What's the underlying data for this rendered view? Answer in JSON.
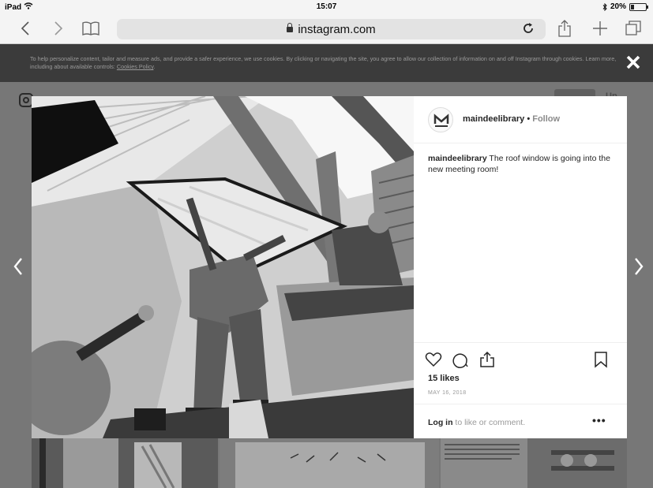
{
  "status_bar": {
    "device": "iPad",
    "time": "15:07",
    "battery": "20%"
  },
  "browser": {
    "domain": "instagram.com"
  },
  "cookie_banner": {
    "text": "To help personalize content, tailor and measure ads, and provide a safer experience, we use cookies. By clicking or navigating the site, you agree to allow our collection of information on and off Instagram through cookies. Learn more, including about available controls: ",
    "link": "Cookies Policy",
    "link_suffix": "."
  },
  "header": {
    "signup": "Up"
  },
  "post": {
    "username": "maindeelibrary",
    "separator": " • ",
    "follow": "Follow",
    "caption_user": "maindeelibrary",
    "caption_text": " The roof window is going into the new meeting room!",
    "likes": "15 likes",
    "date": "MAY 16, 2018",
    "login_link": "Log in",
    "login_suffix": " to like or comment.",
    "more": "•••"
  },
  "icons": [
    "back-icon",
    "forward-icon",
    "bookmarks-icon",
    "reload-icon",
    "share-icon",
    "new-tab-icon",
    "tabs-icon",
    "close-icon",
    "heart-icon",
    "comment-icon",
    "share-post-icon",
    "save-icon",
    "prev-arrow-icon",
    "next-arrow-icon",
    "instagram-logo-icon"
  ]
}
